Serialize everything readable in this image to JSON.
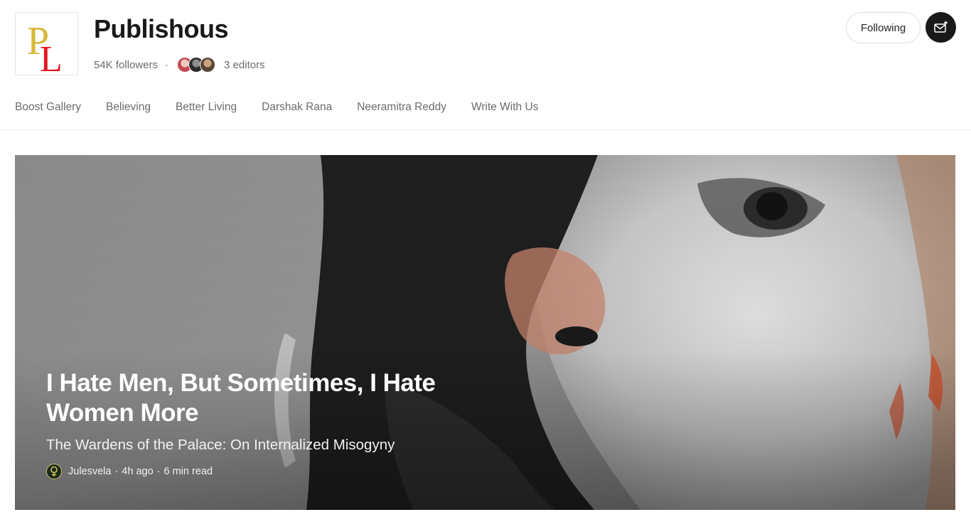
{
  "publication": {
    "title": "Publishous",
    "followers": "54K followers",
    "separator": "·",
    "editors": "3 editors",
    "logo_letters": "PL"
  },
  "header": {
    "following_label": "Following",
    "subscribe_icon": "mail-plus-icon"
  },
  "nav": {
    "items": [
      {
        "label": "Boost Gallery"
      },
      {
        "label": "Believing"
      },
      {
        "label": "Better Living"
      },
      {
        "label": "Darshak Rana"
      },
      {
        "label": "Neeramitra Reddy"
      },
      {
        "label": "Write With Us"
      }
    ]
  },
  "featured": {
    "title": "I Hate Men, But Sometimes, I Hate Women More",
    "subtitle": "The Wardens of the Palace: On Internalized Misogyny",
    "author": "Julesvela",
    "time": "4h ago",
    "read_time": "6 min read",
    "separator": "·"
  },
  "colors": {
    "logo_gold": "#d8b93a",
    "logo_red": "#e0191e",
    "button_dark": "#191919"
  }
}
